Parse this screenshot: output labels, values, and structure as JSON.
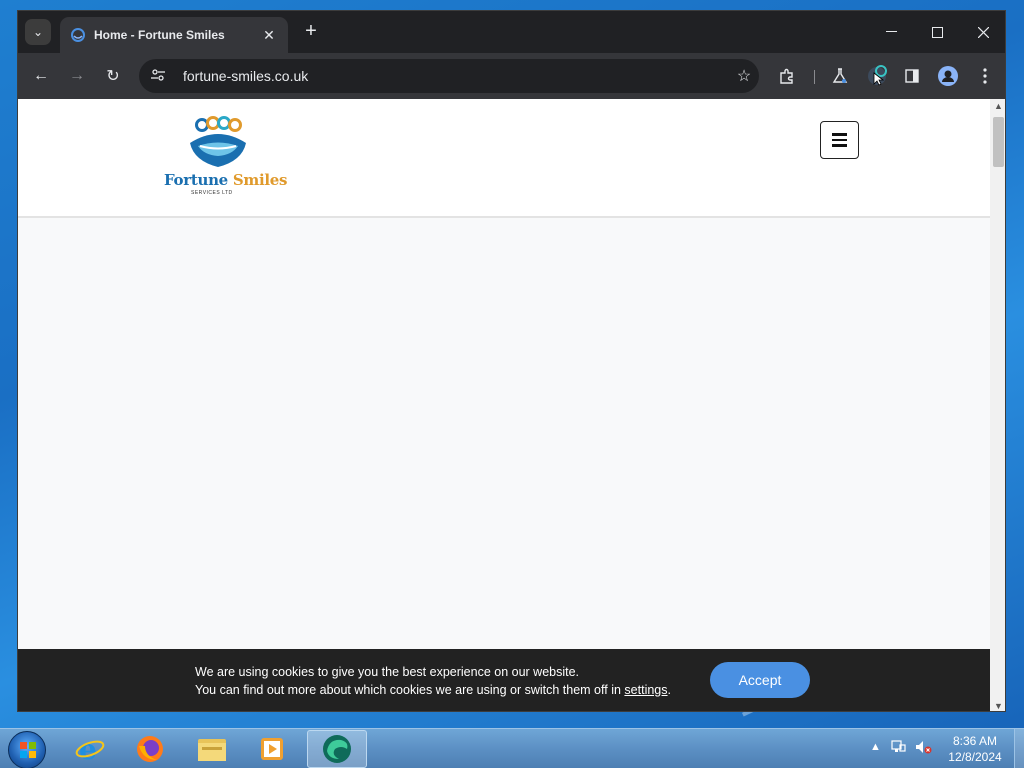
{
  "browser": {
    "tab": {
      "title": "Home - Fortune Smiles",
      "close": "✕"
    },
    "new_tab": "+",
    "window_controls": {
      "minimize": "—",
      "maximize": "☐",
      "close": "✕"
    },
    "nav": {
      "back": "←",
      "forward": "→",
      "reload": "↻"
    },
    "address": {
      "url": "fortune-smiles.co.uk"
    },
    "icons": [
      "tab-search-icon",
      "site-info-icon",
      "bookmark-star-icon",
      "extensions-icon",
      "labs-flask-icon",
      "reading-list-icon",
      "side-panel-icon",
      "profile-icon",
      "menu-dots-icon"
    ]
  },
  "site": {
    "logo": {
      "word1": "Fortune",
      "word2": "Smiles",
      "subtitle": "SERVICES LTD"
    },
    "colors": {
      "logo_blue": "#1a6fb0",
      "logo_orange": "#e09a2c",
      "accept_blue": "#4a90e2"
    }
  },
  "cookie_banner": {
    "line1": "We are using cookies to give you the best experience on our website.",
    "line2_prefix": "You can find out more about which cookies we are using or switch them off in ",
    "line2_link": "settings",
    "line2_suffix": ".",
    "accept_label": "Accept"
  },
  "taskbar": {
    "clock_time": "8:36 AM",
    "clock_date": "12/8/2024",
    "tray_expand": "▲",
    "pinned": [
      "start-orb",
      "internet-explorer-icon",
      "firefox-icon",
      "file-explorer-icon",
      "media-player-icon",
      "edge-like-browser-icon"
    ]
  }
}
